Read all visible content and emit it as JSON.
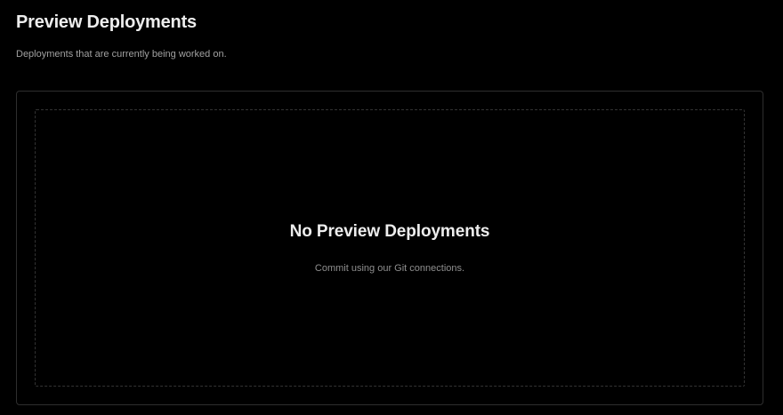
{
  "header": {
    "title": "Preview Deployments",
    "subtitle": "Deployments that are currently being worked on."
  },
  "empty_state": {
    "title": "No Preview Deployments",
    "description": "Commit using our Git connections."
  },
  "colors": {
    "background": "#000000",
    "title_text": "#ededed",
    "muted_text": "#a1a1a1",
    "card_border": "#2e2e2e",
    "dashed_border": "#333333"
  }
}
